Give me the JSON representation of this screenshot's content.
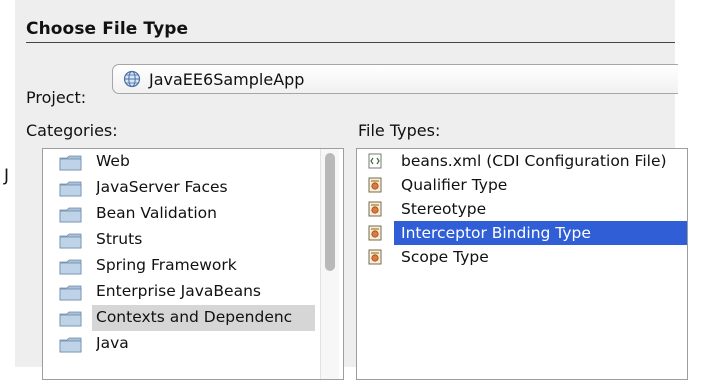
{
  "dialog": {
    "title": "Choose File Type",
    "edge_char": "J"
  },
  "project": {
    "label": "Project:",
    "value": "JavaEE6SampleApp",
    "icon": "globe-icon"
  },
  "categories": {
    "label": "Categories:",
    "items": [
      {
        "label": "Web",
        "icon": "folder-icon",
        "selected": false
      },
      {
        "label": "JavaServer Faces",
        "icon": "folder-icon",
        "selected": false
      },
      {
        "label": "Bean Validation",
        "icon": "folder-icon",
        "selected": false
      },
      {
        "label": "Struts",
        "icon": "folder-icon",
        "selected": false
      },
      {
        "label": "Spring Framework",
        "icon": "folder-icon",
        "selected": false
      },
      {
        "label": "Enterprise JavaBeans",
        "icon": "folder-icon",
        "selected": false
      },
      {
        "label": "Contexts and Dependenc",
        "icon": "folder-icon",
        "selected": true
      },
      {
        "label": "Java",
        "icon": "folder-icon",
        "selected": false
      }
    ]
  },
  "file_types": {
    "label": "File Types:",
    "items": [
      {
        "label": "beans.xml (CDI Configuration File)",
        "icon": "xml-file-icon",
        "selected": false
      },
      {
        "label": "Qualifier Type",
        "icon": "annotation-file-icon",
        "selected": false
      },
      {
        "label": "Stereotype",
        "icon": "annotation-file-icon",
        "selected": false
      },
      {
        "label": "Interceptor Binding Type",
        "icon": "annotation-file-icon",
        "selected": true
      },
      {
        "label": "Scope Type",
        "icon": "annotation-file-icon",
        "selected": false
      }
    ]
  },
  "colors": {
    "selection_blue": "#2f5ed7",
    "selection_gray": "#d6d6d6",
    "panel": "#eeeeee"
  }
}
